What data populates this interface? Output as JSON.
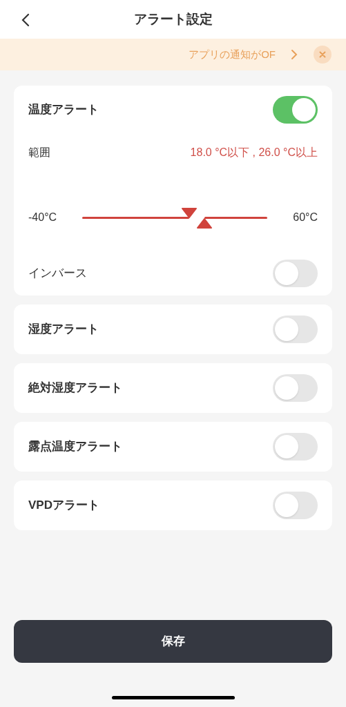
{
  "header": {
    "title": "アラート設定"
  },
  "banner": {
    "text": "アプリの通知がOF"
  },
  "temperature_alert": {
    "label": "温度アラート",
    "on": true,
    "range_label": "範囲",
    "range_value": "18.0 °C以下 , 26.0 °C以上",
    "min_label": "-40°C",
    "max_label": "60°C",
    "low": {
      "level": 0.58
    },
    "high": {
      "level": 0.66
    },
    "inverse": {
      "label": "インバース",
      "on": false
    }
  },
  "alerts": [
    {
      "label": "湿度アラート",
      "on": false
    },
    {
      "label": "絶対湿度アラート",
      "on": false
    },
    {
      "label": "露点温度アラート",
      "on": false
    },
    {
      "label": "VPDアラート",
      "on": false
    }
  ],
  "save_button": "保存"
}
